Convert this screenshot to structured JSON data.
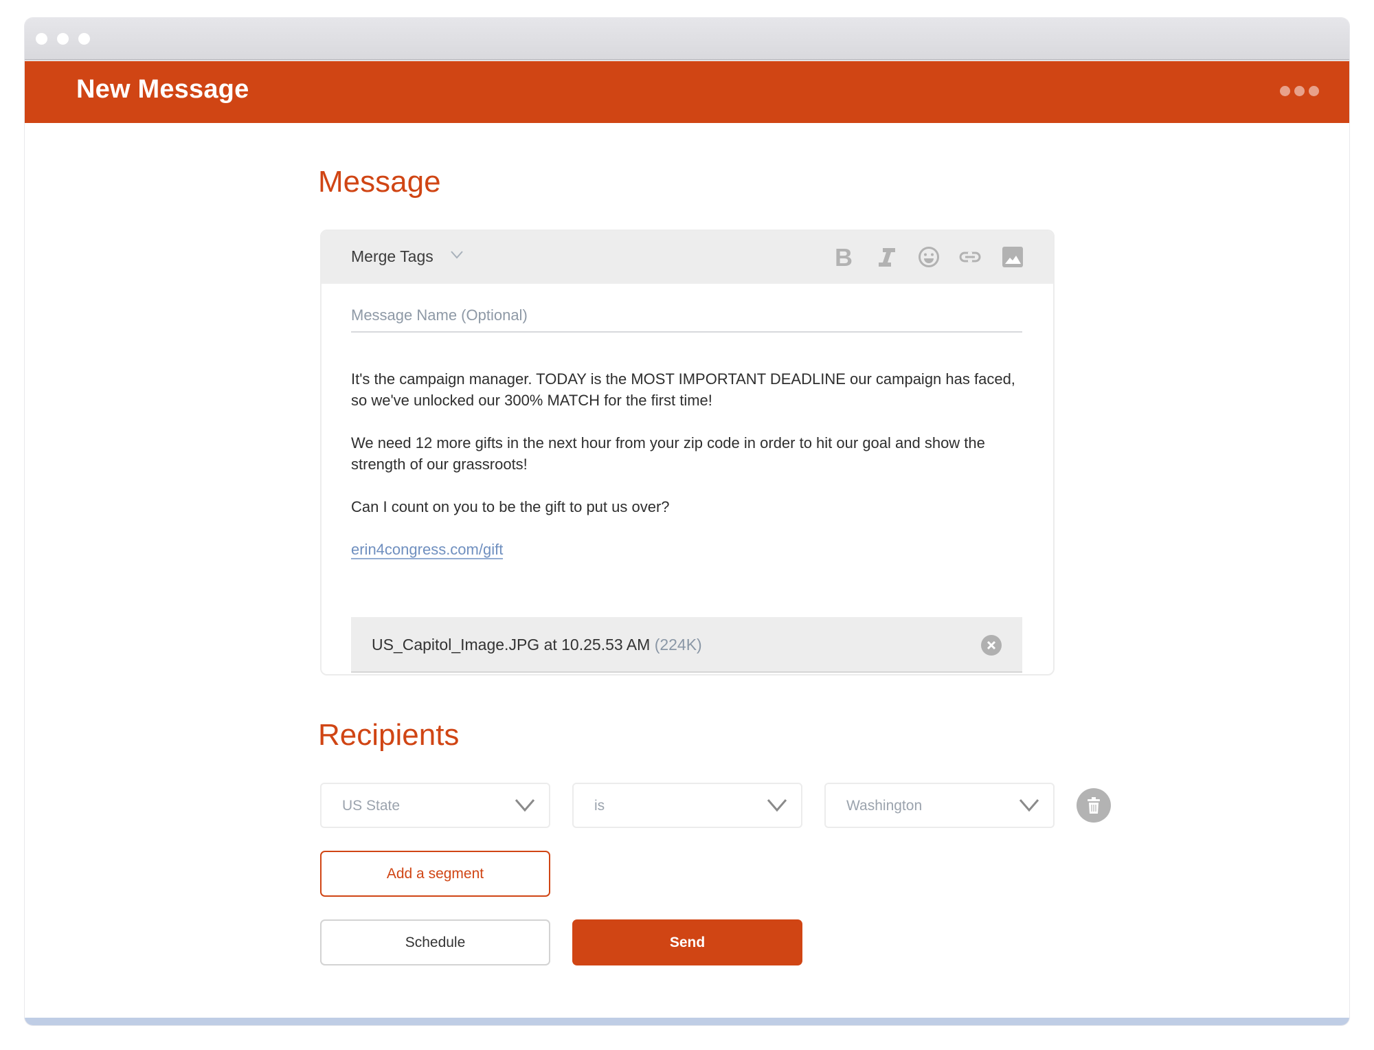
{
  "window": {
    "title": "New Message",
    "traffic_lights": [
      "close",
      "minimize",
      "maximize"
    ],
    "more_icon": "more-horizontal-icon"
  },
  "colors": {
    "brand": "#d04514",
    "toolbar_bg": "#ededed",
    "link": "#6f8fbf",
    "muted_text": "#9ba3ad"
  },
  "message": {
    "heading": "Message",
    "toolbar": {
      "merge_tags_label": "Merge Tags",
      "icons": [
        "bold-icon",
        "italic-icon",
        "emoji-icon",
        "link-icon",
        "image-icon"
      ]
    },
    "name_field": {
      "placeholder": "Message Name (Optional)",
      "value": ""
    },
    "body": {
      "paragraphs": [
        "It's the campaign manager. TODAY is the MOST IMPORTANT DEADLINE our campaign has faced, so we've unlocked our 300% MATCH for the first time!",
        "We need 12 more gifts in the next hour from your zip code in order to hit our goal and show the strength of our grassroots!",
        "Can I count on you to be the gift to put us over?"
      ],
      "link": "erin4congress.com/gift"
    },
    "attachment": {
      "filename": "US_Capitol_Image.JPG at 10.25.53 AM",
      "size": "(224K)"
    }
  },
  "recipients": {
    "heading": "Recipients",
    "filter": {
      "field": "US State",
      "operator": "is",
      "value": "Washington"
    },
    "add_segment_label": "Add a segment"
  },
  "actions": {
    "schedule_label": "Schedule",
    "send_label": "Send"
  }
}
